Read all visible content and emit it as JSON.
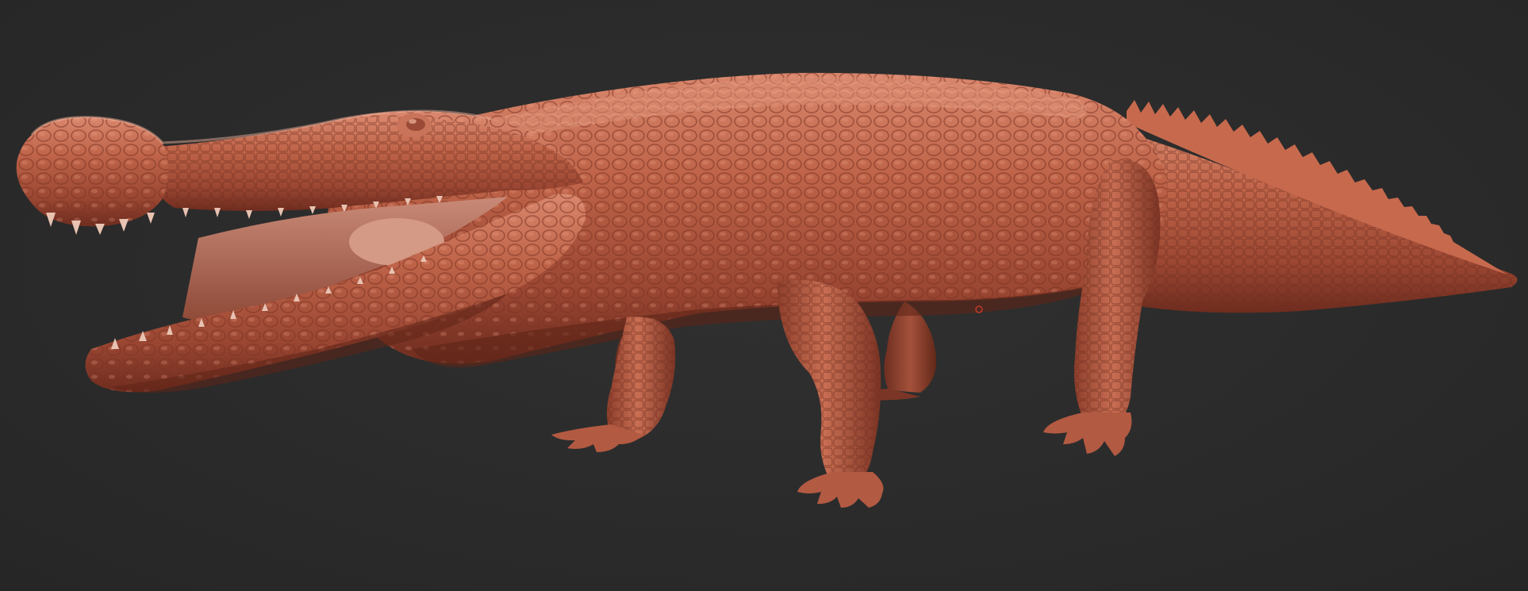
{
  "scene": {
    "subject_icon": "crocodile-sculpt-icon",
    "background_color": "#2b2b2b",
    "material_color": "#b45a44",
    "material_highlight": "#e0957c",
    "material_shadow": "#5a2418"
  }
}
